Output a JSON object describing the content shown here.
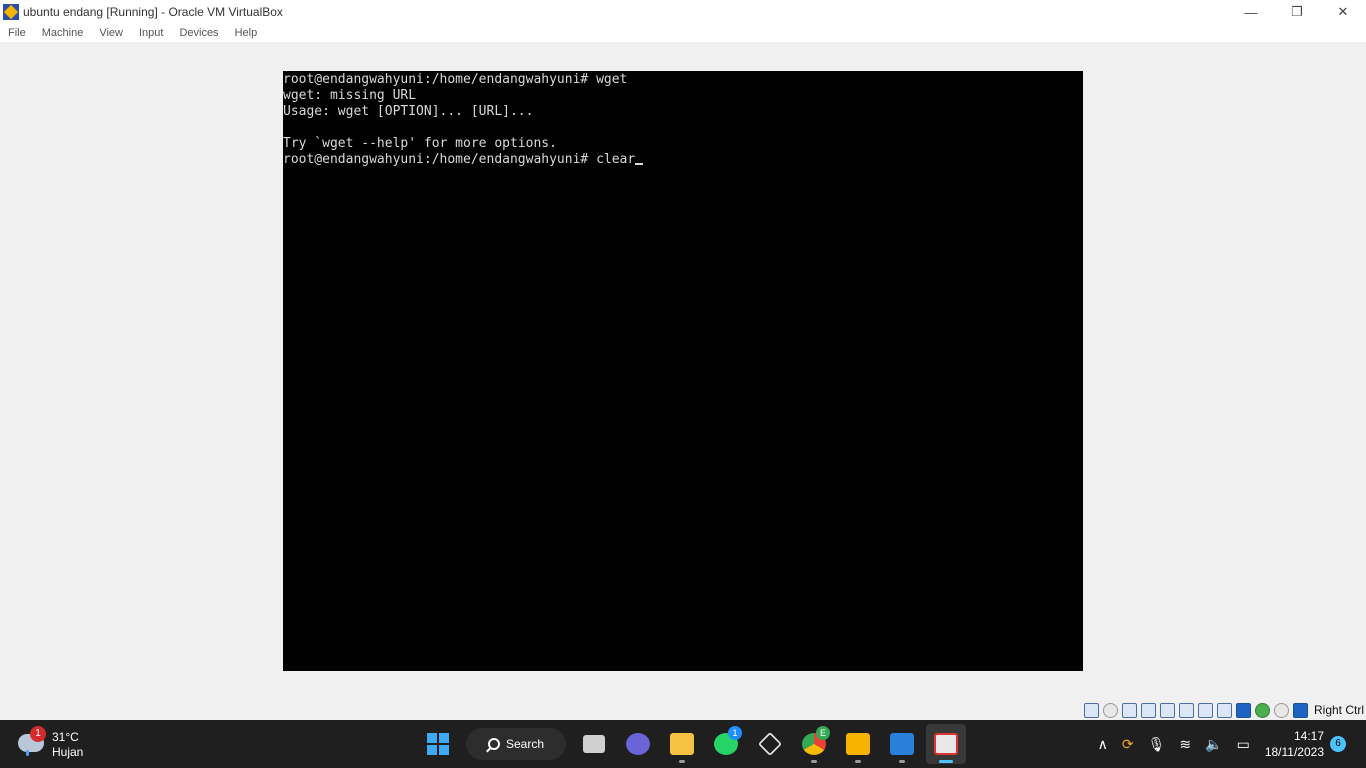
{
  "window": {
    "title": "ubuntu endang [Running] - Oracle VM VirtualBox",
    "controls": {
      "minimize": "—",
      "restore": "❐",
      "close": "✕"
    }
  },
  "menu": {
    "items": [
      "File",
      "Machine",
      "View",
      "Input",
      "Devices",
      "Help"
    ]
  },
  "terminal": {
    "lines": [
      "root@endangwahyuni:/home/endangwahyuni# wget",
      "wget: missing URL",
      "Usage: wget [OPTION]... [URL]...",
      "",
      "Try `wget --help' for more options.",
      "root@endangwahyuni:/home/endangwahyuni# clear"
    ]
  },
  "statusbar": {
    "host_key": "Right Ctrl"
  },
  "taskbar": {
    "weather": {
      "badge": "1",
      "temperature": "31°C",
      "condition": "Hujan"
    },
    "search_label": "Search",
    "whatsapp_badge": "1",
    "chrome_badge": "E",
    "clock": {
      "time": "14:17",
      "date": "18/11/2023"
    },
    "notifications": "6"
  },
  "colors": {
    "terminal_bg": "#000000",
    "terminal_fg": "#d8d8d8",
    "taskbar_bg": "#1f1f1f",
    "accent": "#4cc2ff"
  }
}
